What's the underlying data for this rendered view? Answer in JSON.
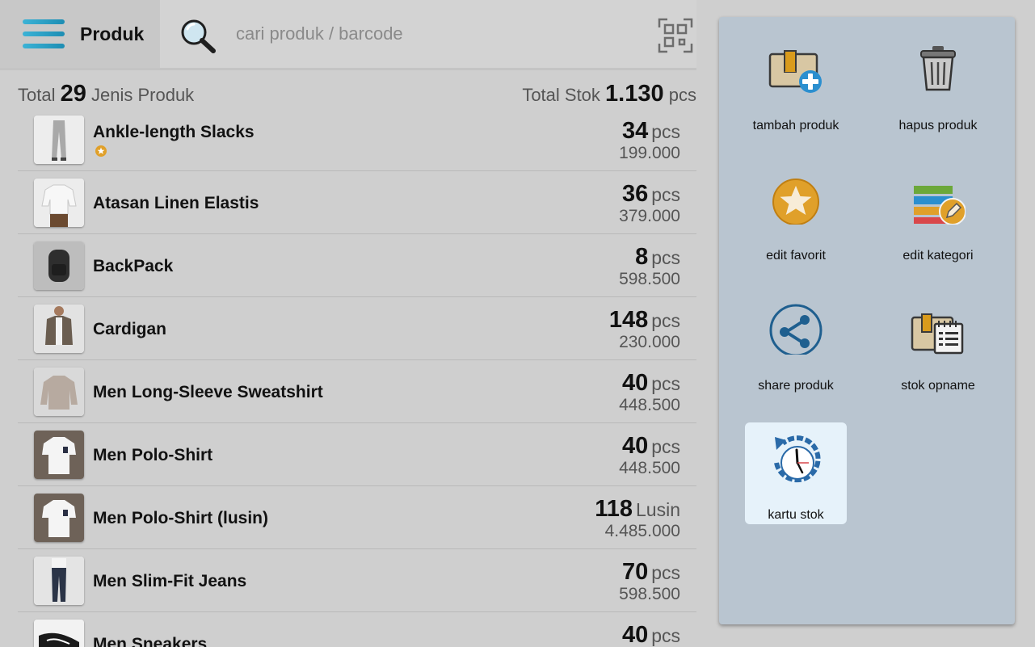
{
  "header": {
    "title": "Produk",
    "search_placeholder": "cari produk / barcode"
  },
  "summary": {
    "total_prefix": "Total",
    "total_count": "29",
    "total_suffix": "Jenis Produk",
    "stock_prefix": "Total Stok",
    "stock_total": "1.130",
    "stock_unit": "pcs"
  },
  "products": [
    {
      "name": "Ankle-length Slacks",
      "qty": "34",
      "unit": "pcs",
      "price": "199.000",
      "favorite": true
    },
    {
      "name": "Atasan Linen Elastis",
      "qty": "36",
      "unit": "pcs",
      "price": "379.000"
    },
    {
      "name": "BackPack",
      "qty": "8",
      "unit": "pcs",
      "price": "598.500"
    },
    {
      "name": "Cardigan",
      "qty": "148",
      "unit": "pcs",
      "price": "230.000"
    },
    {
      "name": "Men Long-Sleeve Sweatshirt",
      "qty": "40",
      "unit": "pcs",
      "price": "448.500"
    },
    {
      "name": "Men Polo-Shirt",
      "qty": "40",
      "unit": "pcs",
      "price": "448.500"
    },
    {
      "name": "Men Polo-Shirt (lusin)",
      "qty": "118",
      "unit": "Lusin",
      "price": "4.485.000"
    },
    {
      "name": "Men Slim-Fit Jeans",
      "qty": "70",
      "unit": "pcs",
      "price": "598.500"
    },
    {
      "name": "Men Sneakers",
      "qty": "40",
      "unit": "pcs",
      "price": ""
    }
  ],
  "actions": [
    {
      "label": "tambah produk",
      "icon": "add-product-icon"
    },
    {
      "label": "hapus produk",
      "icon": "trash-icon"
    },
    {
      "label": "edit favorit",
      "icon": "star-icon"
    },
    {
      "label": "edit kategori",
      "icon": "category-edit-icon"
    },
    {
      "label": "share produk",
      "icon": "share-icon"
    },
    {
      "label": "stok opname",
      "icon": "stock-opname-icon"
    },
    {
      "label": "kartu stok",
      "icon": "stock-card-clock-icon",
      "active": true
    }
  ],
  "colors": {
    "accent": "#1d8db3",
    "panel_bg": "#b9c5d0",
    "active_action_bg": "#e6f2fa",
    "favorite": "#e0a02a"
  }
}
